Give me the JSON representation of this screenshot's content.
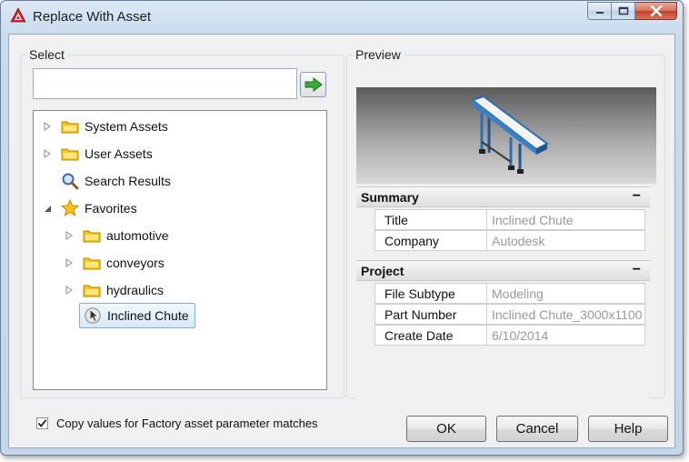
{
  "window": {
    "title": "Replace With Asset",
    "controls": {
      "minimize": "minimize-icon",
      "maximize": "maximize-icon",
      "close": "close-icon"
    }
  },
  "select_group": {
    "label": "Select",
    "search": {
      "value": "",
      "placeholder": ""
    },
    "tree": [
      {
        "label": "System Assets",
        "icon": "folder-icon",
        "expander": "collapsed"
      },
      {
        "label": "User Assets",
        "icon": "folder-icon",
        "expander": "collapsed"
      },
      {
        "label": "Search Results",
        "icon": "magnifier-icon",
        "expander": "none"
      },
      {
        "label": "Favorites",
        "icon": "star-icon",
        "expander": "expanded"
      },
      {
        "label": "automotive",
        "icon": "folder-icon",
        "expander": "collapsed"
      },
      {
        "label": "conveyors",
        "icon": "folder-icon",
        "expander": "collapsed"
      },
      {
        "label": "hydraulics",
        "icon": "folder-icon",
        "expander": "collapsed"
      },
      {
        "label": "Inclined Chute",
        "icon": "asset-cursor-icon",
        "expander": "none",
        "selected": true
      }
    ]
  },
  "preview_group": {
    "label": "Preview",
    "sections": [
      {
        "title": "Summary",
        "collapse": "−",
        "rows": [
          {
            "name": "Title",
            "value": "Inclined Chute"
          },
          {
            "name": "Company",
            "value": "Autodesk"
          }
        ]
      },
      {
        "title": "Project",
        "collapse": "−",
        "rows": [
          {
            "name": "File Subtype",
            "value": "Modeling"
          },
          {
            "name": "Part Number",
            "value": "Inclined Chute_3000x1100"
          },
          {
            "name": "Create Date",
            "value": "6/10/2014"
          }
        ]
      }
    ]
  },
  "footer": {
    "checkbox_label": "Copy values for Factory asset parameter matches",
    "checkbox_checked": true,
    "ok": "OK",
    "cancel": "Cancel",
    "help": "Help"
  },
  "colors": {
    "folder": "#f5c518",
    "go_arrow": "#3aa935",
    "title_bar": "#c9dbee",
    "close_button": "#c24226"
  }
}
